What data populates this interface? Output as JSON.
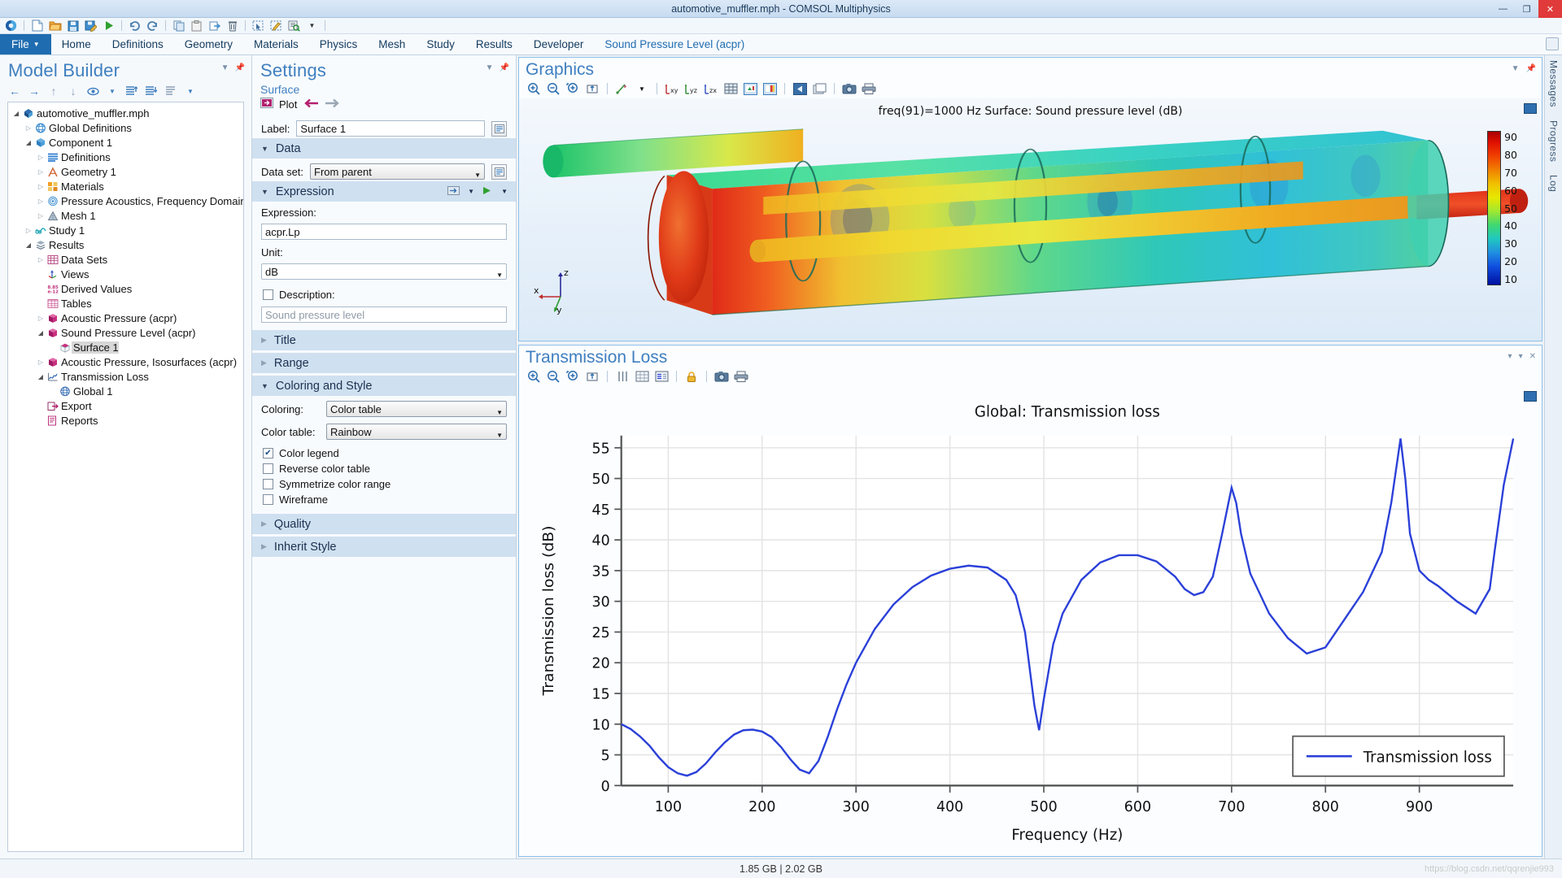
{
  "window": {
    "title": "automotive_muffler.mph - COMSOL Multiphysics",
    "minimize": "—",
    "maximize": "❐",
    "close": "✕"
  },
  "quick_access": [
    {
      "name": "comsol-logo-icon",
      "glyph": "◐"
    },
    {
      "name": "new-file-icon",
      "glyph": "὜b"
    },
    {
      "name": "open-folder-icon",
      "glyph": "Ὄ2"
    },
    {
      "name": "save-icon",
      "glyph": "Ὃe"
    },
    {
      "name": "save-as-icon",
      "glyph": "Ὃe"
    },
    {
      "name": "compute-run-icon",
      "glyph": "▶"
    },
    {
      "name": "undo-icon",
      "glyph": "↶"
    },
    {
      "name": "redo-icon",
      "glyph": "↷"
    },
    {
      "name": "copy-icon",
      "glyph": "⧉"
    },
    {
      "name": "paste-icon",
      "glyph": "Ὄb"
    },
    {
      "name": "duplicate-icon",
      "glyph": "❐"
    },
    {
      "name": "delete-icon",
      "glyph": "Ὕ1"
    },
    {
      "name": "select-box-icon",
      "glyph": "⬚"
    },
    {
      "name": "select-lasso-icon",
      "glyph": "✎"
    },
    {
      "name": "zoom-to-selection-icon",
      "glyph": "ὐd"
    },
    {
      "name": "dropdown-more-icon",
      "glyph": "▼"
    }
  ],
  "ribbon": {
    "file_label": "File",
    "tabs": [
      "Home",
      "Definitions",
      "Geometry",
      "Materials",
      "Physics",
      "Mesh",
      "Study",
      "Results",
      "Developer"
    ],
    "context_tab": "Sound Pressure Level (acpr)"
  },
  "model_builder": {
    "title": "Model Builder",
    "toolbar": [
      {
        "name": "back-arrow-icon",
        "glyph": "←"
      },
      {
        "name": "forward-arrow-icon",
        "glyph": "→"
      },
      {
        "name": "move-up-icon",
        "glyph": "↑"
      },
      {
        "name": "move-down-icon",
        "glyph": "↓"
      },
      {
        "name": "show-eye-icon",
        "glyph": "◉"
      },
      {
        "name": "show-dropdown-icon",
        "glyph": "▼"
      },
      {
        "name": "collapse-all-icon",
        "glyph": "☰"
      },
      {
        "name": "expand-all-icon",
        "glyph": "☰"
      },
      {
        "name": "list-view-icon",
        "glyph": "☰"
      },
      {
        "name": "list-dropdown-icon",
        "glyph": "▼"
      }
    ],
    "tree": [
      {
        "label": "automotive_muffler.mph",
        "indent": 0,
        "arrow": "open",
        "icon": "model-root-icon",
        "color": "#2f6fb0",
        "selected": false
      },
      {
        "label": "Global Definitions",
        "indent": 1,
        "arrow": "closed",
        "icon": "globe-icon",
        "color": "#3f8fd0",
        "selected": false
      },
      {
        "label": "Component 1",
        "indent": 1,
        "arrow": "open",
        "icon": "component-cube-icon",
        "color": "#3f8fd0",
        "selected": false
      },
      {
        "label": "Definitions",
        "indent": 2,
        "arrow": "closed",
        "icon": "definitions-lines-icon",
        "color": "#2f7fd0",
        "selected": false
      },
      {
        "label": "Geometry 1",
        "indent": 2,
        "arrow": "closed",
        "icon": "geometry-icon",
        "color": "#d06a3a",
        "selected": false
      },
      {
        "label": "Materials",
        "indent": 2,
        "arrow": "closed",
        "icon": "materials-icon",
        "color": "#e89a30",
        "selected": false
      },
      {
        "label": "Pressure Acoustics, Frequency Domain",
        "indent": 2,
        "arrow": "closed",
        "icon": "acoustics-wave-icon",
        "color": "#3f8fd0",
        "selected": false
      },
      {
        "label": "Mesh 1",
        "indent": 2,
        "arrow": "closed",
        "icon": "mesh-triangle-icon",
        "color": "#7f93a8",
        "selected": false
      },
      {
        "label": "Study 1",
        "indent": 1,
        "arrow": "closed",
        "icon": "study-icon",
        "color": "#27a8b8",
        "selected": false
      },
      {
        "label": "Results",
        "indent": 1,
        "arrow": "open",
        "icon": "results-icon",
        "color": "#7b8fa4",
        "selected": false
      },
      {
        "label": "Data Sets",
        "indent": 2,
        "arrow": "closed",
        "icon": "data-sets-icon",
        "color": "#b4407f",
        "selected": false
      },
      {
        "label": "Views",
        "indent": 2,
        "arrow": "none",
        "icon": "views-axis-icon",
        "color": "#4aa84a",
        "selected": false
      },
      {
        "label": "Derived Values",
        "indent": 2,
        "arrow": "none",
        "icon": "derived-values-icon",
        "color": "#c2317c",
        "selected": false
      },
      {
        "label": "Tables",
        "indent": 2,
        "arrow": "none",
        "icon": "tables-icon",
        "color": "#d06aa0",
        "selected": false
      },
      {
        "label": "Acoustic Pressure (acpr)",
        "indent": 2,
        "arrow": "closed",
        "icon": "plot-group-icon",
        "color": "#b4206f",
        "selected": false
      },
      {
        "label": "Sound Pressure Level (acpr)",
        "indent": 2,
        "arrow": "open",
        "icon": "plot-group-icon",
        "color": "#b4206f",
        "selected": false
      },
      {
        "label": "Surface 1",
        "indent": 3,
        "arrow": "none",
        "icon": "surface-plot-icon",
        "color": "#b4206f",
        "selected": true
      },
      {
        "label": "Acoustic Pressure, Isosurfaces (acpr)",
        "indent": 2,
        "arrow": "closed",
        "icon": "plot-group-icon",
        "color": "#b4206f",
        "selected": false
      },
      {
        "label": "Transmission Loss",
        "indent": 2,
        "arrow": "open",
        "icon": "graph-plot-icon",
        "color": "#3a6fb5",
        "selected": false
      },
      {
        "label": "Global 1",
        "indent": 3,
        "arrow": "none",
        "icon": "global-plot-icon",
        "color": "#3a6fb5",
        "selected": false
      },
      {
        "label": "Export",
        "indent": 2,
        "arrow": "none",
        "icon": "export-icon",
        "color": "#b4206f",
        "selected": false
      },
      {
        "label": "Reports",
        "indent": 2,
        "arrow": "none",
        "icon": "reports-icon",
        "color": "#b4206f",
        "selected": false
      }
    ]
  },
  "settings": {
    "title": "Settings",
    "subtitle": "Surface",
    "plot_button": "Plot",
    "label_caption": "Label:",
    "label_value": "Surface 1",
    "sections": {
      "data": {
        "header": "Data",
        "data_set_caption": "Data set:",
        "data_set_value": "From parent"
      },
      "expression": {
        "header": "Expression",
        "expression_caption": "Expression:",
        "expression_value": "acpr.Lp",
        "unit_caption": "Unit:",
        "unit_value": "dB",
        "description_caption": "Description:",
        "description_placeholder": "Sound pressure level"
      },
      "title": {
        "header": "Title"
      },
      "range": {
        "header": "Range"
      },
      "coloring_and_style": {
        "header": "Coloring and Style",
        "coloring_caption": "Coloring:",
        "coloring_value": "Color table",
        "color_table_caption": "Color table:",
        "color_table_value": "Rainbow",
        "checkboxes": [
          {
            "label": "Color legend",
            "checked": true
          },
          {
            "label": "Reverse color table",
            "checked": false
          },
          {
            "label": "Symmetrize color range",
            "checked": false
          },
          {
            "label": "Wireframe",
            "checked": false
          }
        ]
      },
      "quality": {
        "header": "Quality"
      },
      "inherit_style": {
        "header": "Inherit Style"
      }
    }
  },
  "graphics": {
    "title": "Graphics",
    "toolbar": [
      {
        "name": "zoom-in-icon",
        "glyph": "⊕"
      },
      {
        "name": "zoom-out-icon",
        "glyph": "⊖"
      },
      {
        "name": "zoom-extents-icon",
        "glyph": "⊕"
      },
      {
        "name": "zoom-box-icon",
        "glyph": "⧉"
      },
      {
        "name": "scene-light-icon",
        "glyph": "✵"
      },
      {
        "name": "scene-light-dropdown-icon",
        "glyph": "▼"
      },
      {
        "name": "view-xy-icon",
        "glyph": "xy"
      },
      {
        "name": "view-yz-icon",
        "glyph": "yz"
      },
      {
        "name": "view-zx-icon",
        "glyph": "zx"
      },
      {
        "name": "show-grid-icon",
        "glyph": "⊞"
      },
      {
        "name": "color-legend-icon",
        "glyph": "▤"
      },
      {
        "name": "color-table-icon",
        "glyph": "▧"
      },
      {
        "name": "previous-frame-icon",
        "glyph": "◀"
      },
      {
        "name": "copy-image-icon",
        "glyph": "⧉"
      },
      {
        "name": "snapshot-camera-icon",
        "glyph": "὏7"
      },
      {
        "name": "print-icon",
        "glyph": "⎙"
      }
    ],
    "plot_caption": "freq(91)=1000 Hz   Surface: Sound pressure level (dB)",
    "legend_ticks": [
      "90",
      "80",
      "70",
      "60",
      "50",
      "40",
      "30",
      "20",
      "10"
    ],
    "axis_triad": {
      "x": "x",
      "y": "y",
      "z": "z"
    }
  },
  "transmission_loss": {
    "title": "Transmission Loss",
    "toolbar": [
      {
        "name": "zoom-in-icon",
        "glyph": "⊕"
      },
      {
        "name": "zoom-out-icon",
        "glyph": "⊖"
      },
      {
        "name": "zoom-extents-icon",
        "glyph": "⊕"
      },
      {
        "name": "zoom-box-icon",
        "glyph": "⧉"
      },
      {
        "name": "grid-lines-icon",
        "glyph": "‖"
      },
      {
        "name": "table-view-icon",
        "glyph": "▦"
      },
      {
        "name": "legend-toggle-icon",
        "glyph": "▤"
      },
      {
        "name": "lock-axis-icon",
        "glyph": "ὑ2"
      },
      {
        "name": "snapshot-camera-icon",
        "glyph": "὏7"
      },
      {
        "name": "print-icon",
        "glyph": "⎙"
      }
    ],
    "panel_controls": {
      "minimize": "▾",
      "maximize": "▾",
      "close": "✕"
    }
  },
  "chart_data": {
    "type": "line",
    "title": "Global: Transmission loss",
    "xlabel": "Frequency (Hz)",
    "ylabel": "Transmission loss (dB)",
    "xlim": [
      50,
      1000
    ],
    "ylim": [
      0,
      57
    ],
    "xticks": [
      100,
      200,
      300,
      400,
      500,
      600,
      700,
      800,
      900
    ],
    "yticks": [
      0,
      5,
      10,
      15,
      20,
      25,
      30,
      35,
      40,
      45,
      50,
      55
    ],
    "grid": true,
    "legend_position": "bottom-right",
    "series": [
      {
        "name": "Transmission loss",
        "color": "#2b40d8",
        "x": [
          50,
          60,
          70,
          80,
          90,
          100,
          110,
          120,
          130,
          140,
          150,
          160,
          170,
          180,
          190,
          200,
          210,
          220,
          230,
          240,
          250,
          260,
          270,
          280,
          290,
          300,
          320,
          340,
          360,
          380,
          400,
          420,
          440,
          460,
          470,
          480,
          490,
          495,
          500,
          510,
          520,
          540,
          560,
          580,
          600,
          620,
          640,
          650,
          660,
          670,
          680,
          690,
          700,
          705,
          710,
          720,
          740,
          760,
          780,
          800,
          820,
          840,
          860,
          870,
          880,
          885,
          890,
          900,
          910,
          920,
          940,
          960,
          975,
          980,
          990,
          1000
        ],
        "y": [
          10.0,
          9.2,
          8.0,
          6.5,
          4.6,
          3.0,
          2.0,
          1.6,
          2.2,
          3.6,
          5.4,
          7.0,
          8.3,
          9.0,
          9.1,
          8.8,
          7.9,
          6.3,
          4.3,
          2.6,
          2.0,
          4.0,
          8.0,
          12.5,
          16.5,
          20.0,
          25.5,
          29.5,
          32.3,
          34.2,
          35.3,
          35.8,
          35.5,
          33.5,
          31.0,
          25.0,
          13.0,
          9.0,
          14.0,
          23.0,
          28.0,
          33.5,
          36.3,
          37.5,
          37.5,
          36.5,
          34.0,
          32.0,
          31.0,
          31.5,
          34.0,
          41.0,
          48.5,
          46.0,
          41.0,
          34.5,
          28.0,
          24.0,
          21.5,
          22.5,
          27.0,
          31.5,
          38.0,
          46.0,
          56.5,
          50.0,
          41.0,
          35.0,
          33.5,
          32.5,
          30.0,
          28.0,
          32.0,
          38.0,
          49.0,
          56.5
        ],
        "legend_label": "Transmission loss"
      }
    ]
  },
  "right_strip": {
    "items": [
      "Messages",
      "Progress",
      "Log"
    ]
  },
  "status_bar": {
    "memory": "1.85 GB | 2.02 GB",
    "watermark": "https://blog.csdn.net/qqrenjie993"
  }
}
